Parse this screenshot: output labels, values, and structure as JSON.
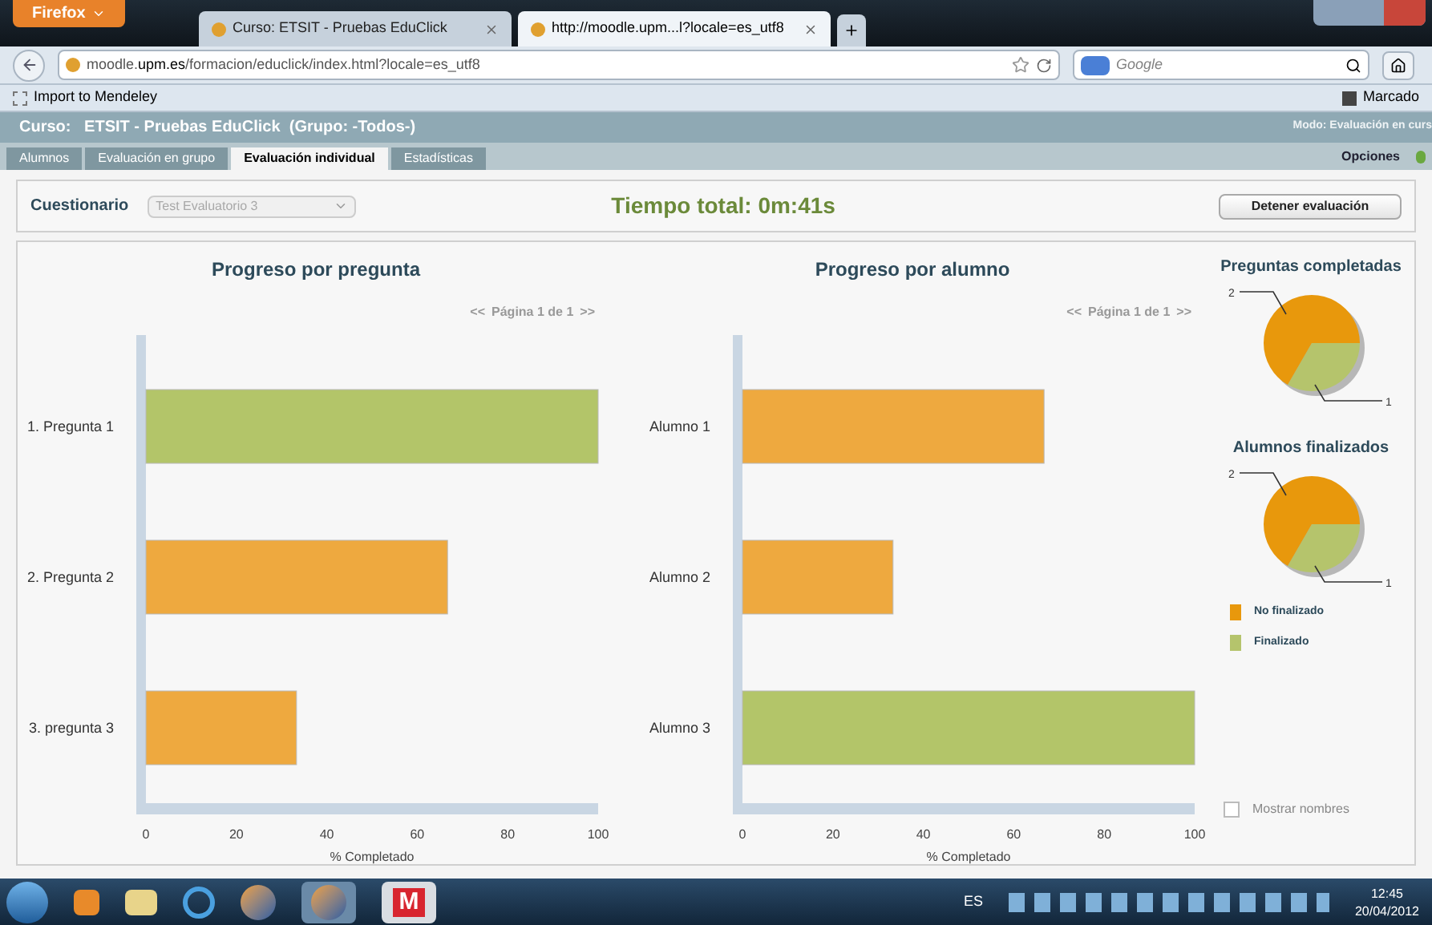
{
  "browser": {
    "menu_button": "Firefox",
    "tabs": [
      {
        "title": "Curso: ETSIT - Pruebas EduClick",
        "selected": false
      },
      {
        "title": "http://moodle.upm...l?locale=es_utf8",
        "selected": true
      }
    ],
    "url_prefix": "moodle.",
    "url_domain": "upm.es",
    "url_rest": "/formacion/educlick/index.html?locale=es_utf8",
    "search": {
      "placeholder": "Google"
    },
    "bookmark": "Import to Mendeley",
    "bookmark_right": "Marcado"
  },
  "course": {
    "title": "Curso:   ETSIT - Pruebas EduClick  (Grupo: -Todos-)",
    "mode": "Modo: Evaluación en curs",
    "tabs": [
      {
        "label": "Alumnos",
        "selected": false
      },
      {
        "label": "Evaluación en grupo",
        "selected": false
      },
      {
        "label": "Evaluación individual",
        "selected": true
      },
      {
        "label": "Estadísticas",
        "selected": false
      }
    ],
    "options": "Opciones"
  },
  "toolbar": {
    "label": "Cuestionario",
    "select": {
      "value": "Test Evaluatorio 3",
      "disabled": true
    },
    "timer": "Tiempo total: 0m:41s",
    "stop_button": "Detener evaluación"
  },
  "bar_charts": [
    {
      "pager": {
        "prev": "<<",
        "text": "Página 1 de 1",
        "next": ">>"
      },
      "chart_data": {
        "type": "bar",
        "orientation": "horizontal",
        "title": "Progreso por pregunta",
        "xlabel": "% Completado",
        "categories": [
          "1. Pregunta 1",
          "2. Pregunta 2",
          "3. pregunta 3"
        ],
        "values": [
          100,
          66.7,
          33.3
        ],
        "colors": [
          "#b3c569",
          "#eea93f",
          "#eea93f"
        ],
        "xlim": [
          0,
          100
        ],
        "xticks": [
          0,
          20,
          40,
          60,
          80,
          100
        ]
      }
    },
    {
      "pager": {
        "prev": "<<",
        "text": "Página 1 de 1",
        "next": ">>"
      },
      "chart_data": {
        "type": "bar",
        "orientation": "horizontal",
        "title": "Progreso por alumno",
        "xlabel": "% Completado",
        "categories": [
          "Alumno 1",
          "Alumno 2",
          "Alumno 3"
        ],
        "values": [
          66.7,
          33.3,
          100
        ],
        "colors": [
          "#eea93f",
          "#eea93f",
          "#b3c569"
        ],
        "xlim": [
          0,
          100
        ],
        "xticks": [
          0,
          20,
          40,
          60,
          80,
          100
        ]
      }
    }
  ],
  "pie_charts": [
    {
      "chart_data": {
        "type": "pie",
        "title": "Preguntas completadas",
        "values": [
          2,
          1
        ],
        "data_labels": true
      }
    },
    {
      "chart_data": {
        "type": "pie",
        "title": "Alumnos finalizados",
        "values": [
          2,
          1
        ],
        "data_labels": true
      }
    }
  ],
  "legend": [
    {
      "label": "No finalizado",
      "color": "#e8980c"
    },
    {
      "label": "Finalizado",
      "color": "#b5c46c"
    }
  ],
  "show_names": {
    "label": "Mostrar nombres",
    "checked": false
  },
  "taskbar": {
    "app_letter": "M",
    "language": "ES",
    "time": "12:45",
    "date": "20/04/2012"
  }
}
